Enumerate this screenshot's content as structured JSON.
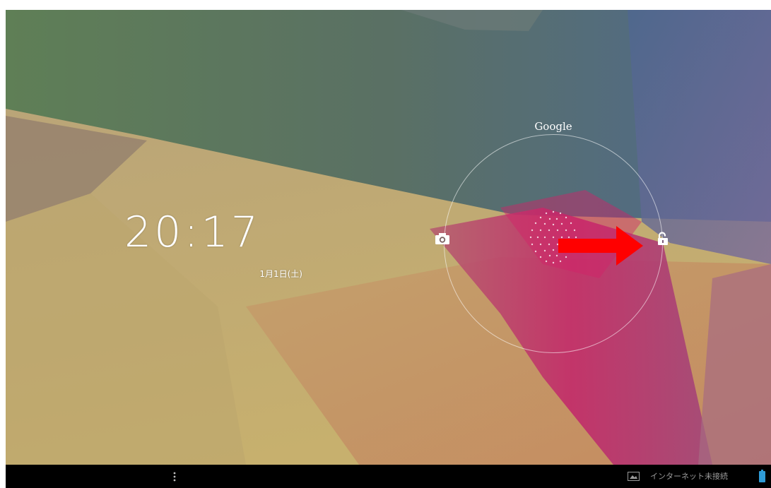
{
  "lockscreen": {
    "time": "20:17",
    "date": "1月1日(土)",
    "search_label": "Google",
    "camera_target_icon": "camera-icon",
    "unlock_target_icon": "unlocked-padlock-icon",
    "annotation_arrow_icon": "red-arrow-icon",
    "annotation_color": "#ff0000"
  },
  "system_bar": {
    "menu_icon": "overflow-menu-icon",
    "notification_icon": "gallery-image-icon",
    "network_status": "インターネット未接続",
    "battery_icon": "battery-icon",
    "battery_color": "#2f9bd6"
  }
}
